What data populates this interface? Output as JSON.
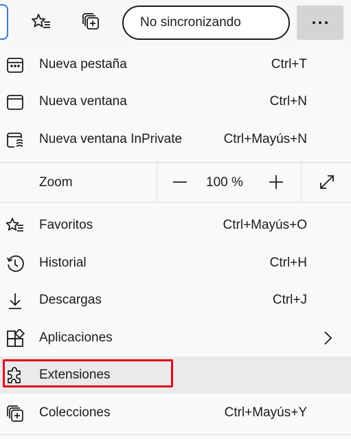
{
  "toolbar": {
    "favorites_icon": "star-list-icon",
    "collections_icon": "collections-icon",
    "profile_label": "No sincronizando",
    "more_icon": "more-icon"
  },
  "menu": {
    "items_top": [
      {
        "label": "Nueva pestaña",
        "shortcut": "Ctrl+T",
        "icon": "new-tab-icon"
      },
      {
        "label": "Nueva ventana",
        "shortcut": "Ctrl+N",
        "icon": "new-window-icon"
      },
      {
        "label": "Nueva ventana InPrivate",
        "shortcut": "Ctrl+Mayús+N",
        "icon": "inprivate-icon"
      }
    ],
    "zoom": {
      "label": "Zoom",
      "value": "100 %"
    },
    "items_bottom": [
      {
        "label": "Favoritos",
        "shortcut": "Ctrl+Mayús+O",
        "icon": "favorites-icon"
      },
      {
        "label": "Historial",
        "shortcut": "Ctrl+H",
        "icon": "history-icon"
      },
      {
        "label": "Descargas",
        "shortcut": "Ctrl+J",
        "icon": "download-icon"
      },
      {
        "label": "Aplicaciones",
        "shortcut": "",
        "icon": "apps-icon"
      },
      {
        "label": "Extensiones",
        "shortcut": "",
        "icon": "extensions-icon"
      },
      {
        "label": "Colecciones",
        "shortcut": "Ctrl+Mayús+Y",
        "icon": "collections-icon"
      }
    ],
    "highlighted": "Extensiones"
  },
  "colors": {
    "highlight_box": "#e3001b",
    "hover": "#eaeaea",
    "text": "#1b1b1b"
  }
}
